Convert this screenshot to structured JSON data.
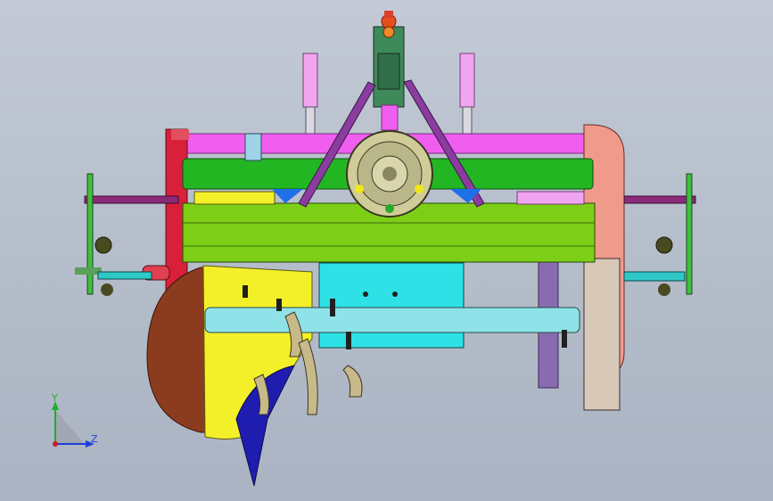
{
  "viewport": {
    "background_top": "#c3cad6",
    "background_bottom": "#aab3c2"
  },
  "triad": {
    "y_label": "Y",
    "z_label": "Z",
    "y_color": "#1fae2a",
    "z_color": "#1d3fd8",
    "x_color": "#d21b1b"
  },
  "model": {
    "part_colors": {
      "top_bar": "#f05ef0",
      "green_tube": "#23b623",
      "main_frame": "#7ccf16",
      "gearbox": "#cfcc9a",
      "yellow_cover": "#f3f02a",
      "blue_shield": "#1f1cb0",
      "brown_drum": "#8b3c1e",
      "cyan_shaft": "#8fe3e8",
      "cyan_plate": "#2ee1e7",
      "pink_disc": "#f09a8c",
      "purple_arms": "#8a3c9f",
      "tines": "#c7b98a"
    }
  }
}
